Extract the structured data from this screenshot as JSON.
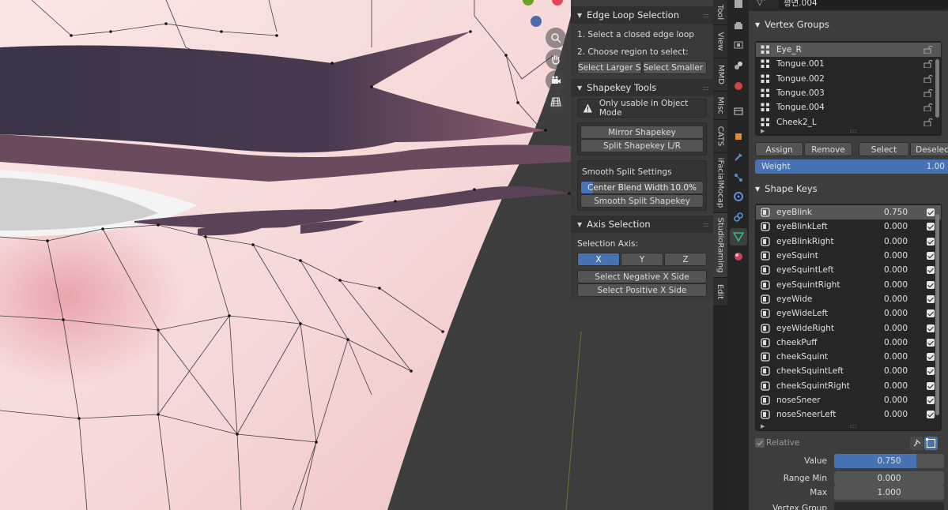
{
  "viewport": {
    "object_name": "평면.004",
    "nav_icons": [
      "zoom-icon",
      "hand-icon",
      "camera-icon",
      "grid-icon"
    ]
  },
  "npanel": {
    "edge_loop": {
      "title": "Edge Loop Selection",
      "step1": "1. Select a closed edge loop",
      "step2": "2. Choose region to select:",
      "btn_larger": "Select Larger Si...",
      "btn_smaller": "Select Smaller S..."
    },
    "shapekey_tools": {
      "title": "Shapekey Tools",
      "warning": "Only usable in Object Mode",
      "btn_mirror": "Mirror Shapekey",
      "btn_split": "Split Shapekey L/R",
      "smooth_title": "Smooth Split Settings",
      "blend_label": "Center Blend Width",
      "blend_value": "10.0%",
      "blend_fraction": 0.1,
      "btn_smooth": "Smooth Split Shapekey"
    },
    "axis_selection": {
      "title": "Axis Selection",
      "axis_label": "Selection Axis:",
      "axes": [
        "X",
        "Y",
        "Z"
      ],
      "active_axis": "X",
      "btn_negative": "Select Negative X Side",
      "btn_positive": "Select Positive X Side"
    }
  },
  "tabs": [
    "Tool",
    "View",
    "MMD",
    "Misc",
    "CATS",
    "iFacialMocap",
    "StudioRaming",
    "Edit"
  ],
  "active_tab": "StudioRaming",
  "props": {
    "vertex_groups": {
      "title": "Vertex Groups",
      "items": [
        "Eye_R",
        "Tongue.001",
        "Tongue.002",
        "Tongue.003",
        "Tongue.004",
        "Cheek2_L"
      ],
      "selected": "Eye_R",
      "btn_assign": "Assign",
      "btn_remove": "Remove",
      "btn_select": "Select",
      "btn_deselect": "Deselect",
      "weight_label": "Weight",
      "weight_value": "1.00"
    },
    "shape_keys": {
      "title": "Shape Keys",
      "items": [
        {
          "name": "eyeBlink",
          "value": "0.750"
        },
        {
          "name": "eyeBlinkLeft",
          "value": "0.000"
        },
        {
          "name": "eyeBlinkRight",
          "value": "0.000"
        },
        {
          "name": "eyeSquint",
          "value": "0.000"
        },
        {
          "name": "eyeSquintLeft",
          "value": "0.000"
        },
        {
          "name": "eyeSquintRight",
          "value": "0.000"
        },
        {
          "name": "eyeWide",
          "value": "0.000"
        },
        {
          "name": "eyeWideLeft",
          "value": "0.000"
        },
        {
          "name": "eyeWideRight",
          "value": "0.000"
        },
        {
          "name": "cheekPuff",
          "value": "0.000"
        },
        {
          "name": "cheekSquint",
          "value": "0.000"
        },
        {
          "name": "cheekSquintLeft",
          "value": "0.000"
        },
        {
          "name": "cheekSquintRight",
          "value": "0.000"
        },
        {
          "name": "noseSneer",
          "value": "0.000"
        },
        {
          "name": "noseSneerLeft",
          "value": "0.000"
        }
      ],
      "selected": "eyeBlink",
      "relative_label": "Relative",
      "value_label": "Value",
      "value": "0.750",
      "value_fraction": 0.75,
      "range_min_label": "Range Min",
      "range_min": "0.000",
      "max_label": "Max",
      "max": "1.000",
      "vertex_group_label": "Vertex Group"
    }
  },
  "colors": {
    "accent": "#4772b3",
    "panel": "#303030",
    "skin": "#f3cfcf",
    "eyelash": "#4e3f52"
  }
}
